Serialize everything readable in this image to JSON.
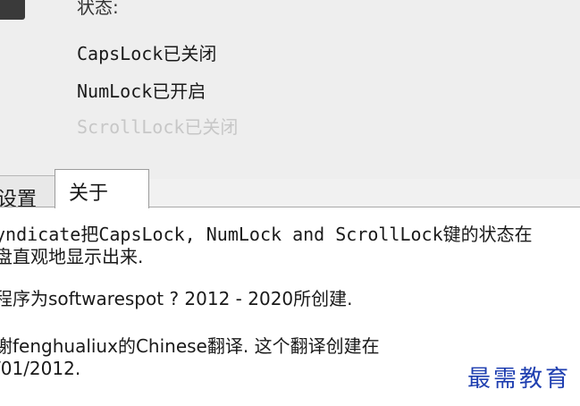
{
  "status": {
    "heading": "状态:",
    "caps": {
      "key": "CapsLock",
      "state": "已关闭"
    },
    "num": {
      "key": "NumLock",
      "state": "已开启"
    },
    "scroll": {
      "key": "ScrollLock",
      "state": "已关闭"
    }
  },
  "tabs": {
    "settings_label": "设置",
    "about_label": "关于"
  },
  "about": {
    "p1_line1": "yndicate把CapsLock, NumLock and ScrollLock键的状态在",
    "p1_line2": "盘直观地显示出来.",
    "p2": "程序为softwarespot ? 2012 - 2020所创建.",
    "p3_line1": "谢fenghualiux的Chinese翻译. 这个翻译创建在",
    "p3_line2": "/01/2012."
  },
  "watermark": "最需教育"
}
